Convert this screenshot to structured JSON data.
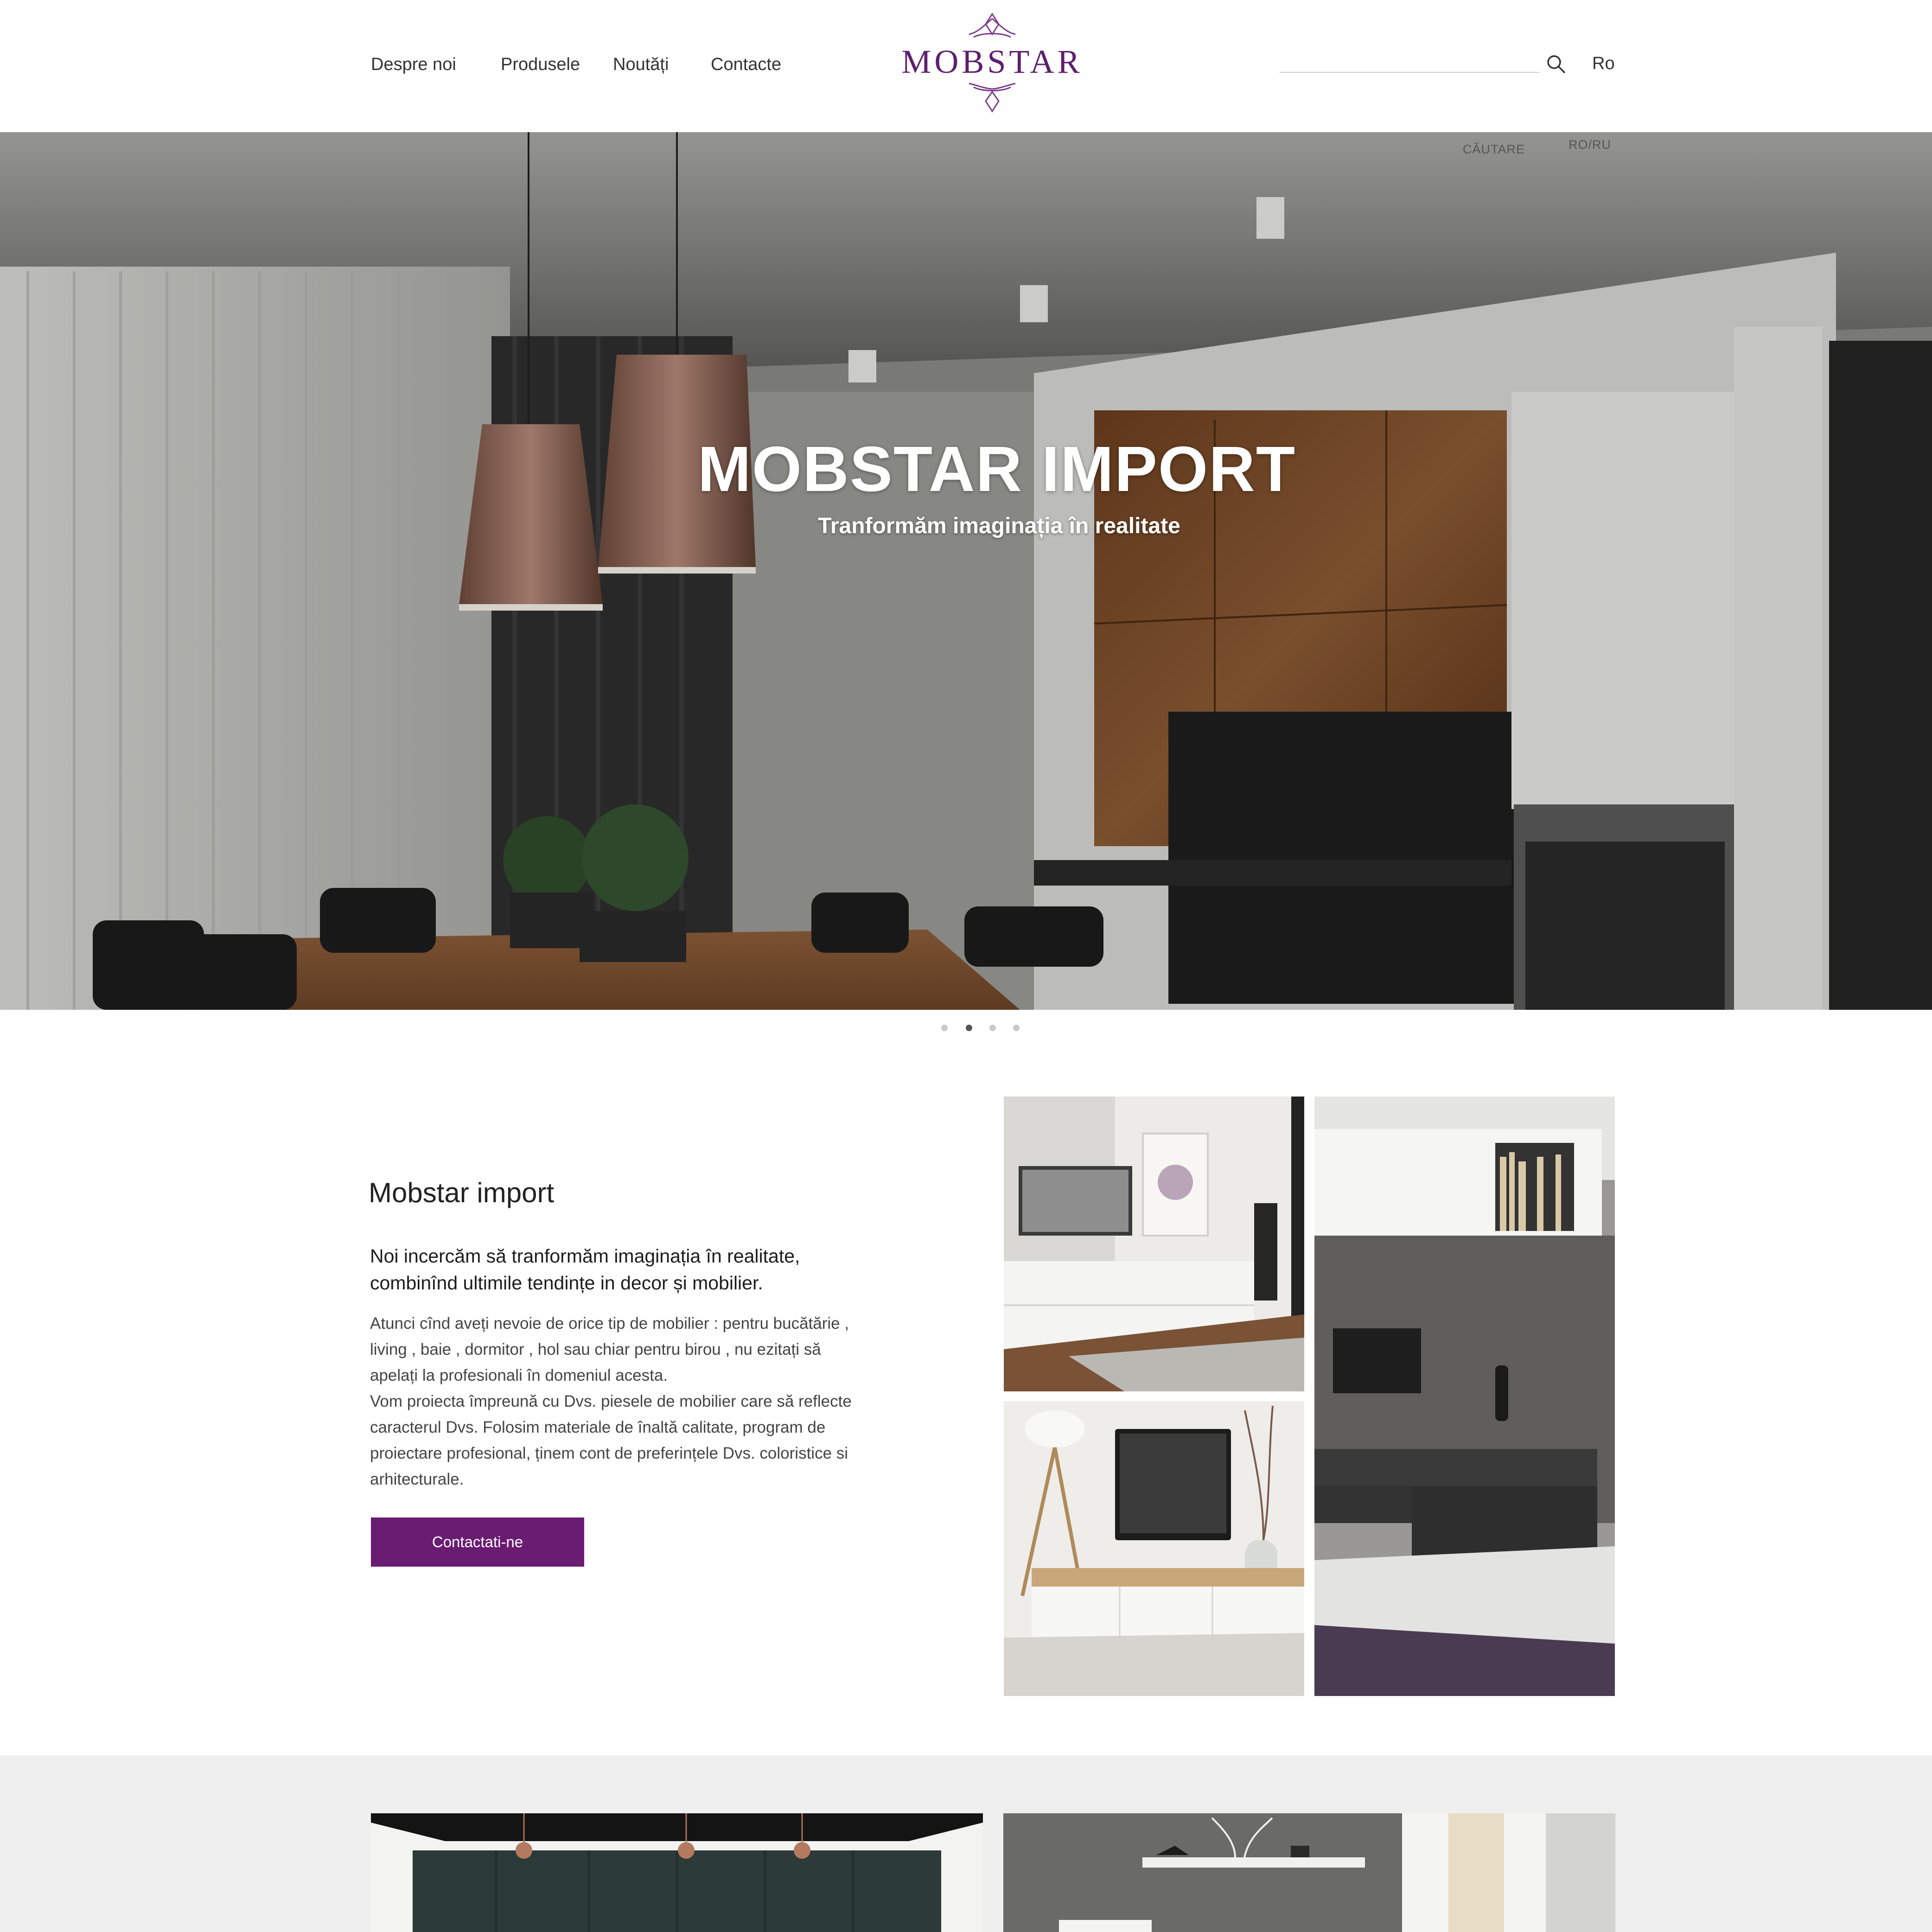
{
  "header": {
    "nav": [
      "Despre noi",
      "Produsele",
      "Noutăți",
      "Contacte"
    ],
    "logo_text": "MOBSTAR",
    "search_value": "",
    "lang_current": "Ro"
  },
  "hero": {
    "search_label": "CĂUTARE",
    "lang_label": "RO/RU",
    "title": "MOBSTAR IMPORT",
    "subtitle": "Tranformăm imaginația în realitate",
    "slide_count": 4,
    "active_slide": 2
  },
  "about": {
    "title": "Mobstar import",
    "lead_lines": [
      "Noi incercăm să tranformăm imaginația în realitate,",
      "combinînd ultimile tendințe in decor și mobilier."
    ],
    "body_lines": [
      "Atunci cînd aveți nevoie de orice tip de mobilier : pentru bucătărie ,",
      "living , baie , dormitor , hol sau chiar pentru birou , nu ezitați să",
      "apelați la profesionali în domeniul acesta.",
      "Vom proiecta împreună cu Dvs. piesele de mobilier care să reflecte",
      "caracterul Dvs.  Folosim materiale de înaltă calitate, program de",
      "proiectare profesional, ținem cont de preferințele  Dvs. coloristice si",
      "arhitecturale."
    ],
    "button_label": "Contactati-ne"
  },
  "colors": {
    "accent": "#6a1b72",
    "logo": "#5e1f6e",
    "bottom_bg": "#efefef"
  }
}
